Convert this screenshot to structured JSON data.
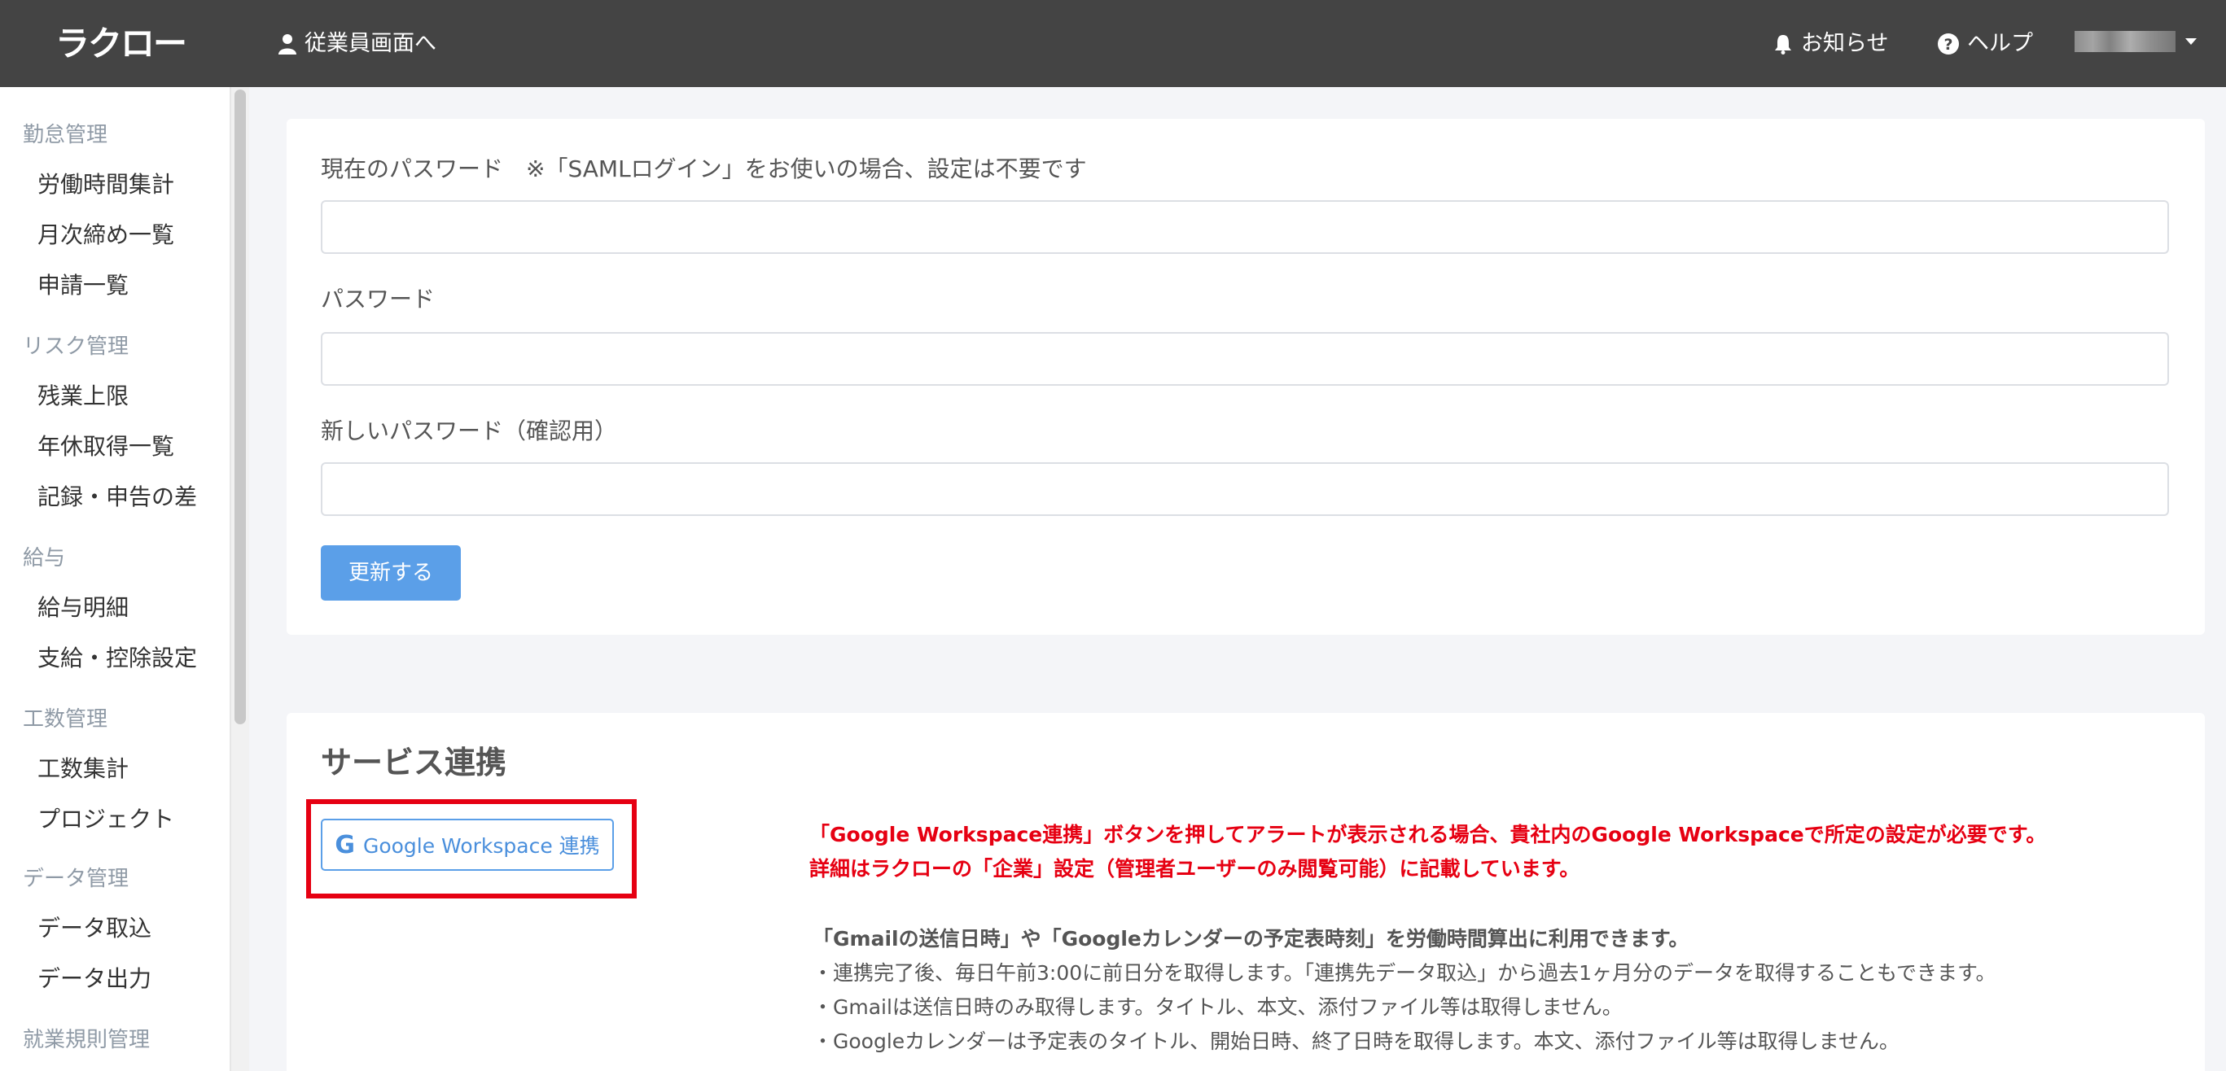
{
  "header": {
    "logo": "ラクロー",
    "employee_link": "従業員画面へ",
    "news": "お知らせ",
    "help": "ヘルプ"
  },
  "sidebar": {
    "groups": [
      {
        "label": "勤怠管理",
        "items": [
          "労働時間集計",
          "月次締め一覧",
          "申請一覧"
        ]
      },
      {
        "label": "リスク管理",
        "items": [
          "残業上限",
          "年休取得一覧",
          "記録・申告の差"
        ]
      },
      {
        "label": "給与",
        "items": [
          "給与明細",
          "支給・控除設定"
        ]
      },
      {
        "label": "工数管理",
        "items": [
          "工数集計",
          "プロジェクト"
        ]
      },
      {
        "label": "データ管理",
        "items": [
          "データ取込",
          "データ出力"
        ]
      },
      {
        "label": "就業規則管理",
        "items": []
      }
    ]
  },
  "password_form": {
    "current_label": "現在のパスワード　※「SAMLログイン」をお使いの場合、設定は不要です",
    "current_value": "",
    "new_label": "パスワード",
    "new_value": "",
    "confirm_label": "新しいパスワード（確認用）",
    "confirm_value": "",
    "submit": "更新する"
  },
  "service": {
    "title": "サービス連携",
    "button": "Google Workspace 連携",
    "notice_line1": "「Google Workspace連携」ボタンを押してアラートが表示される場合、貴社内のGoogle Workspaceで所定の設定が必要です。",
    "notice_line2": "詳細はラクローの「企業」設定（管理者ユーザーのみ閲覧可能）に記載しています。",
    "info_head": "「Gmailの送信日時」や「Googleカレンダーの予定表時刻」を労働時間算出に利用できます。",
    "info_lines": [
      "・連携完了後、毎日午前3:00に前日分を取得します。「連携先データ取込」から過去1ヶ月分のデータを取得することもできます。",
      "・Gmailは送信日時のみ取得します。タイトル、本文、添付ファイル等は取得しません。",
      "・Googleカレンダーは予定表のタイトル、開始日時、終了日時を取得します。本文、添付ファイル等は取得しません。"
    ]
  },
  "colors": {
    "header_bg": "#444444",
    "primary": "#5b9fe8",
    "alert_red": "#e60012"
  }
}
